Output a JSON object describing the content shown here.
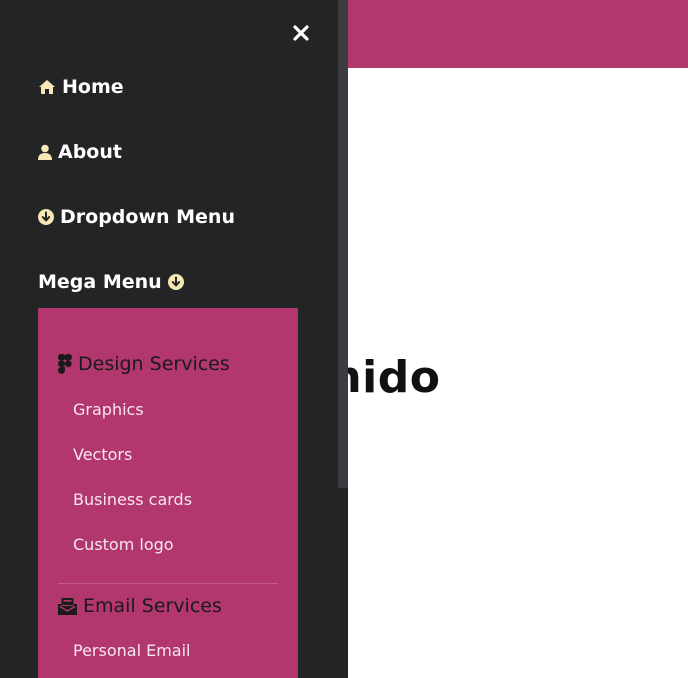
{
  "colors": {
    "accent": "#b2376e",
    "drawer_bg": "#232426",
    "icon_color": "#f6e7b4"
  },
  "page": {
    "heading": "enido"
  },
  "drawer": {
    "close_icon": "close-icon",
    "items": [
      {
        "label": "Home",
        "icon": "home-icon"
      },
      {
        "label": "About",
        "icon": "user-icon"
      },
      {
        "label": "Dropdown Menu",
        "icon": "arrow-circle-down-icon"
      },
      {
        "label": "Mega Menu",
        "icon": "arrow-circle-down-icon"
      }
    ]
  },
  "mega_menu": {
    "categories": [
      {
        "title": "Design Services",
        "icon": "figma-icon",
        "links": [
          "Graphics",
          "Vectors",
          "Business cards",
          "Custom logo"
        ]
      },
      {
        "title": "Email Services",
        "icon": "mail-bulk-icon",
        "links": [
          "Personal Email"
        ]
      }
    ]
  }
}
